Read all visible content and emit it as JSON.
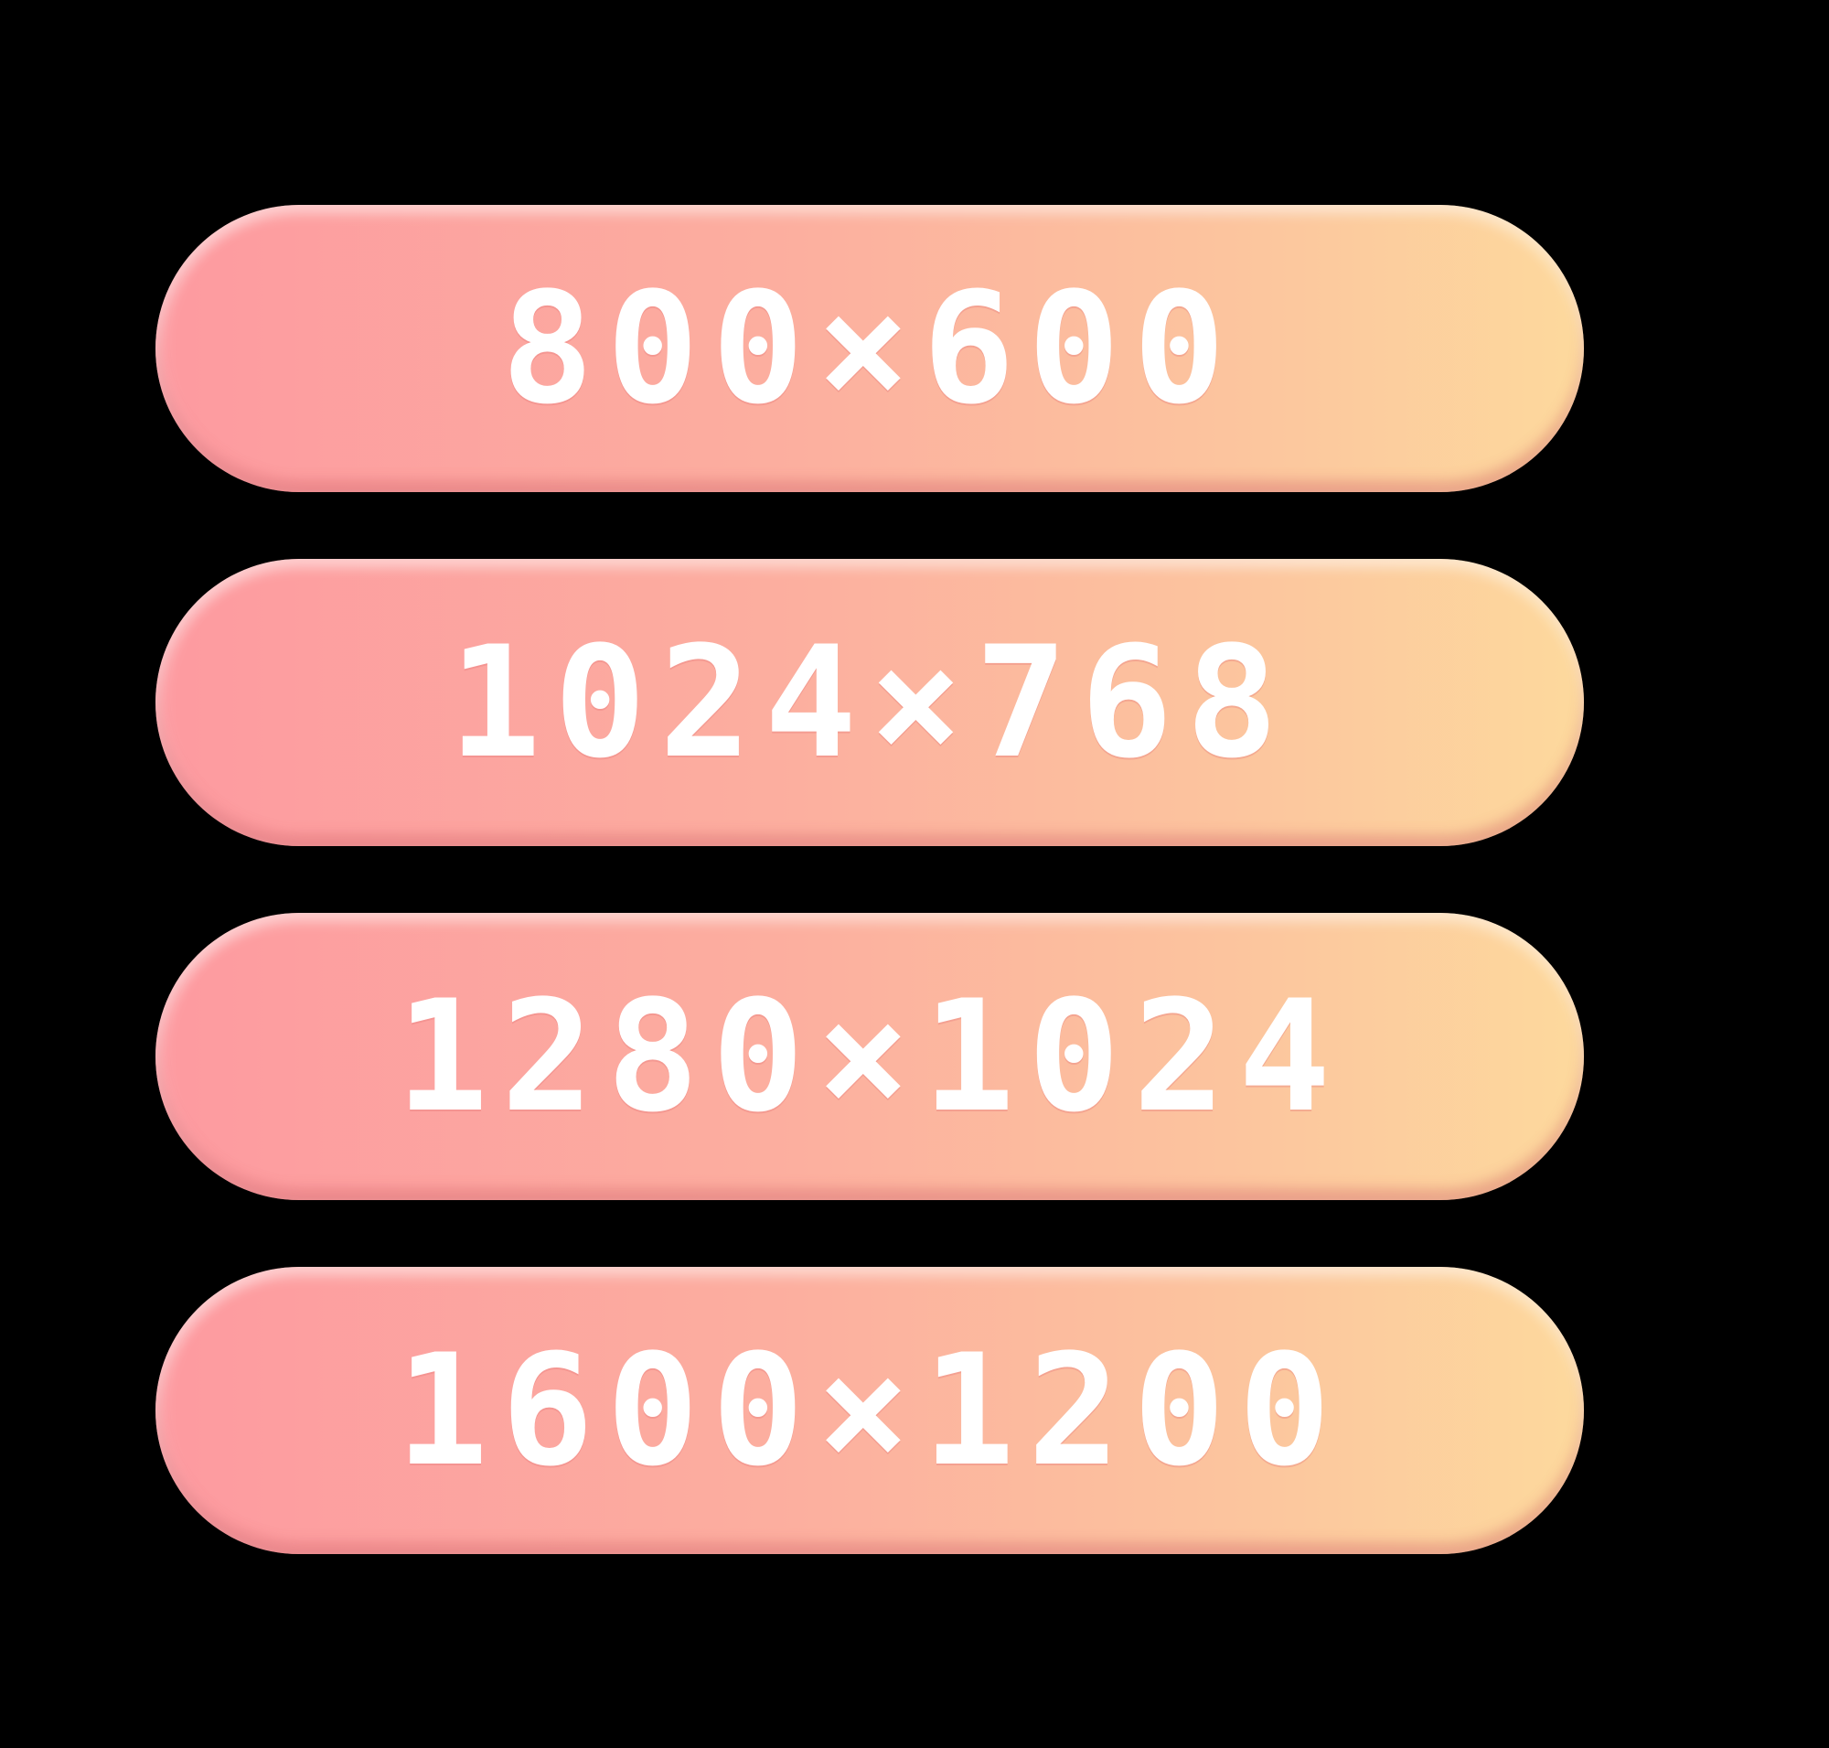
{
  "resolution_menu": {
    "options": [
      {
        "label": "800×600"
      },
      {
        "label": "1024×768"
      },
      {
        "label": "1280×1024"
      },
      {
        "label": "1600×1200"
      }
    ]
  },
  "colors": {
    "background": "#000000",
    "button_gradient_start": "#fd9aa0",
    "button_gradient_end": "#fdd99d",
    "label": "#ffffff"
  }
}
